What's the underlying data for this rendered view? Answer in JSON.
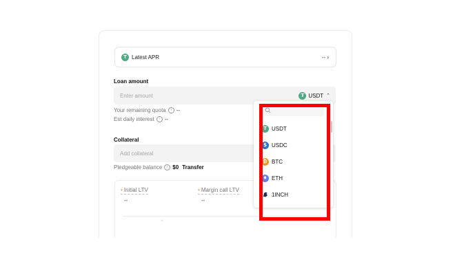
{
  "apr": {
    "coin_glyph": "T",
    "label": "Latest APR",
    "value": "-- ›"
  },
  "loan": {
    "title": "Loan amount",
    "placeholder": "Enter amount",
    "asset": "USDT",
    "caret": "⌃",
    "remaining_quota_label": "Your remaining quota",
    "remaining_quota_value": "--",
    "daily_interest_label": "Est daily interest",
    "daily_interest_value": "--",
    "info_glyph": "i"
  },
  "collateral": {
    "title": "Collateral",
    "placeholder": "Add collateral",
    "pledgeable_label": "Pledgeable balance",
    "pledgeable_value": "$0",
    "transfer_label": "Transfer"
  },
  "ltv": {
    "initial_label": "Initial LTV",
    "initial_value": "--",
    "margin_call_label": "Margin call LTV",
    "margin_call_value": "--",
    "bullet": "•"
  },
  "dropdown": {
    "search_placeholder": "",
    "search_icon": "search-icon",
    "items": [
      {
        "symbol": "USDT",
        "glyph": "T",
        "color": "#50a987"
      },
      {
        "symbol": "USDC",
        "glyph": "$",
        "color": "#2775ca"
      },
      {
        "symbol": "BTC",
        "glyph": "₿",
        "color": "#f7931a"
      },
      {
        "symbol": "ETH",
        "glyph": "♦",
        "color": "#627eea"
      },
      {
        "symbol": "1INCH",
        "glyph": "🐴",
        "color": "#1b314f"
      }
    ]
  },
  "colors": {
    "highlight": "#ff0000",
    "accent_bullet": "#e0a43c",
    "input_bg": "#f3f3f3"
  }
}
